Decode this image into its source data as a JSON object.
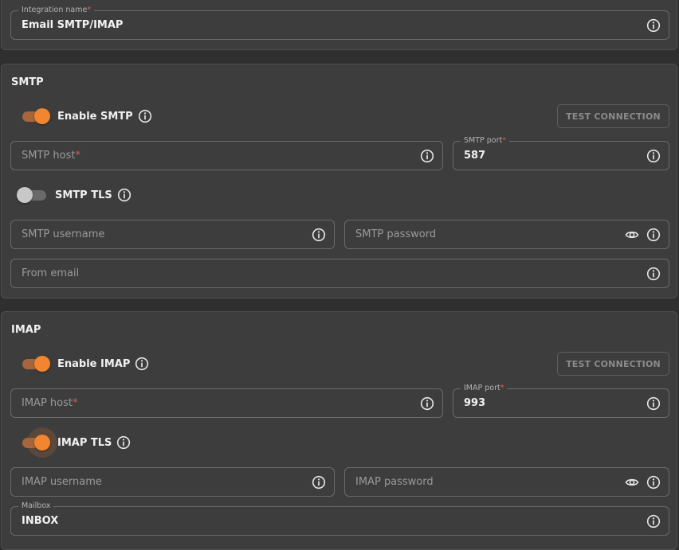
{
  "integration": {
    "name_label": "Integration name",
    "name_value": "Email SMTP/IMAP"
  },
  "smtp": {
    "title": "SMTP",
    "enable_label": "Enable SMTP",
    "enabled": true,
    "test_button": "TEST CONNECTION",
    "host_placeholder": "SMTP host",
    "port_label": "SMTP port",
    "port_value": "587",
    "tls_label": "SMTP TLS",
    "tls_enabled": false,
    "username_placeholder": "SMTP username",
    "password_placeholder": "SMTP password",
    "from_email_placeholder": "From email"
  },
  "imap": {
    "title": "IMAP",
    "enable_label": "Enable IMAP",
    "enabled": true,
    "test_button": "TEST CONNECTION",
    "host_placeholder": "IMAP host",
    "port_label": "IMAP port",
    "port_value": "993",
    "tls_label": "IMAP TLS",
    "tls_enabled": true,
    "username_placeholder": "IMAP username",
    "password_placeholder": "IMAP password",
    "mailbox_label": "Mailbox",
    "mailbox_value": "INBOX"
  },
  "required_mark": "*",
  "icons": {
    "info": "info-icon",
    "eye": "eye-icon"
  },
  "colors": {
    "accent": "#f2852f",
    "accent_track": "#a6653a",
    "required": "#e05a5a",
    "panel": "#3d3d3d",
    "background": "#2f2f2f"
  }
}
